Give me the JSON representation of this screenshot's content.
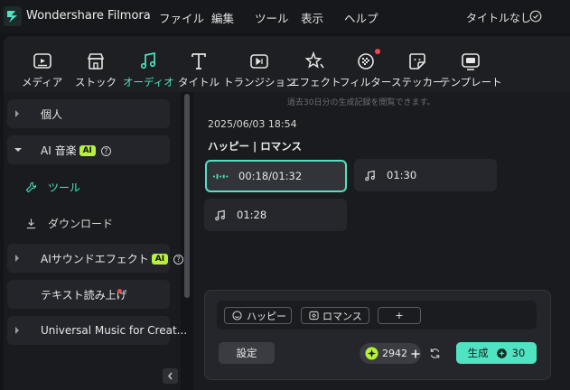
{
  "app": {
    "title": "Wondershare Filmora",
    "project_title": "タイトルなし"
  },
  "menu": [
    "ファイル",
    "編集",
    "ツール",
    "表示",
    "ヘルプ"
  ],
  "toolbar": {
    "tabs": [
      {
        "label": "メディア",
        "icon": "media-icon"
      },
      {
        "label": "ストック",
        "icon": "stock-icon"
      },
      {
        "label": "オーディオ",
        "icon": "music-note-icon",
        "active": true
      },
      {
        "label": "タイトル",
        "icon": "title-text-icon"
      },
      {
        "label": "トランジション",
        "icon": "transition-icon"
      },
      {
        "label": "エフェクト",
        "icon": "effects-star-icon"
      },
      {
        "label": "フィルター",
        "icon": "filter-icon",
        "notification": true
      },
      {
        "label": "ステッカー",
        "icon": "sticker-icon"
      },
      {
        "label": "テンプレート",
        "icon": "template-icon"
      }
    ]
  },
  "sidebar": {
    "personal": "個人",
    "ai_music": "AI 音楽",
    "ai_badge": "AI",
    "tools": "ツール",
    "download": "ダウンロード",
    "ai_sound_effects": "AIサウンドエフェクト",
    "tts": "テキスト読み上げ",
    "universal_music": "Universal Music for Creat..."
  },
  "main": {
    "notice": "過去30日分の生成記録を閲覧できます。",
    "timestamp": "2025/06/03 18:54",
    "group_title": "ハッピー | ロマンス",
    "tracks": [
      {
        "label": "00:18/01:32",
        "playing": true
      },
      {
        "label": "01:30"
      },
      {
        "label": "01:28"
      }
    ]
  },
  "generator": {
    "tags": [
      "ハッピー",
      "ロマンス"
    ],
    "add_tag": "+",
    "settings": "設定",
    "credits": "2942",
    "generate": "生成",
    "generate_cost": "30"
  },
  "colors": {
    "accent": "#4fe3c2",
    "ai_badge": "#b5f23a",
    "notification": "#f0484e",
    "credits_icon": "#b5f23a"
  }
}
